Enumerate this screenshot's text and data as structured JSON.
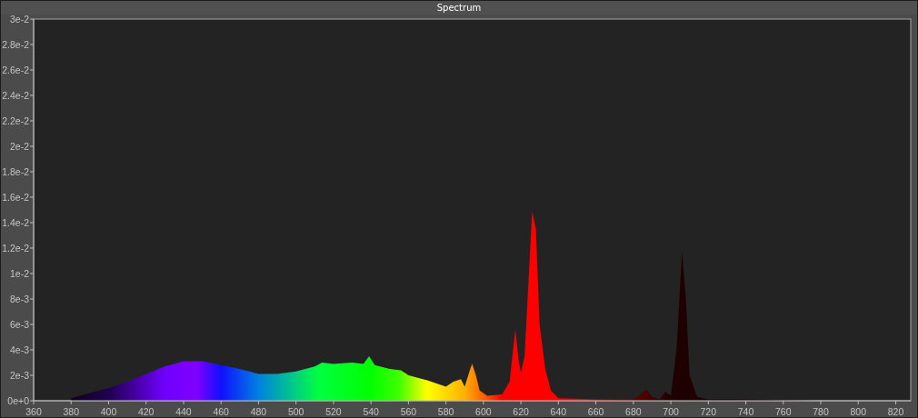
{
  "window": {
    "title": "Spectrum"
  },
  "chart": {
    "chart_data": {
      "type": "area",
      "x": [
        380,
        390,
        400,
        410,
        420,
        430,
        440,
        450,
        460,
        470,
        480,
        490,
        500,
        510,
        514,
        520,
        530,
        536,
        539,
        542,
        550,
        556,
        560,
        570,
        580,
        584,
        588,
        590,
        593,
        594,
        596,
        598,
        602,
        610,
        614,
        617,
        619,
        620,
        622,
        626,
        628,
        630,
        633,
        636,
        640,
        660,
        680,
        684,
        687,
        690,
        694,
        697,
        700,
        703,
        706,
        708,
        710,
        714,
        720,
        740,
        780,
        828
      ],
      "series": [
        {
          "values": [
            0.0002,
            0.0006,
            0.001,
            0.0015,
            0.0021,
            0.0027,
            0.0031,
            0.0031,
            0.0028,
            0.0025,
            0.0021,
            0.0021,
            0.0023,
            0.0027,
            0.003,
            0.0029,
            0.003,
            0.0029,
            0.0035,
            0.0028,
            0.0025,
            0.0024,
            0.002,
            0.0016,
            0.0011,
            0.0015,
            0.0017,
            0.0011,
            0.0025,
            0.0029,
            0.002,
            0.0008,
            0.0004,
            0.0005,
            0.0015,
            0.0056,
            0.003,
            0.0022,
            0.0035,
            0.0149,
            0.0135,
            0.006,
            0.0025,
            0.0008,
            0.0002,
            0.0001,
            0.0001,
            0.0005,
            0.0009,
            0.0003,
            0.0001,
            0.0007,
            0.0004,
            0.004,
            0.0117,
            0.008,
            0.002,
            0.0003,
            0.0001,
            0.0001,
            0,
            0
          ]
        }
      ],
      "xlim": [
        360,
        828
      ],
      "ylim": [
        0,
        0.03
      ],
      "xticks": [
        360,
        380,
        400,
        420,
        440,
        460,
        480,
        500,
        520,
        540,
        560,
        580,
        600,
        620,
        640,
        660,
        680,
        700,
        720,
        740,
        760,
        780,
        800,
        820
      ],
      "yticks": [
        {
          "value": 0,
          "label": "0e+0"
        },
        {
          "value": 0.002,
          "label": "2e-3"
        },
        {
          "value": 0.004,
          "label": "4e-3"
        },
        {
          "value": 0.006,
          "label": "6e-3"
        },
        {
          "value": 0.008,
          "label": "8e-3"
        },
        {
          "value": 0.01,
          "label": "1e-2"
        },
        {
          "value": 0.012,
          "label": "1.2e-2"
        },
        {
          "value": 0.014,
          "label": "1.4e-2"
        },
        {
          "value": 0.016,
          "label": "1.6e-2"
        },
        {
          "value": 0.018,
          "label": "1.8e-2"
        },
        {
          "value": 0.02,
          "label": "2e-2"
        },
        {
          "value": 0.022,
          "label": "2.2e-2"
        },
        {
          "value": 0.024,
          "label": "2.4e-2"
        },
        {
          "value": 0.026,
          "label": "2.6e-2"
        },
        {
          "value": 0.028,
          "label": "2.8e-2"
        },
        {
          "value": 0.03,
          "label": "3e-2"
        }
      ]
    }
  }
}
